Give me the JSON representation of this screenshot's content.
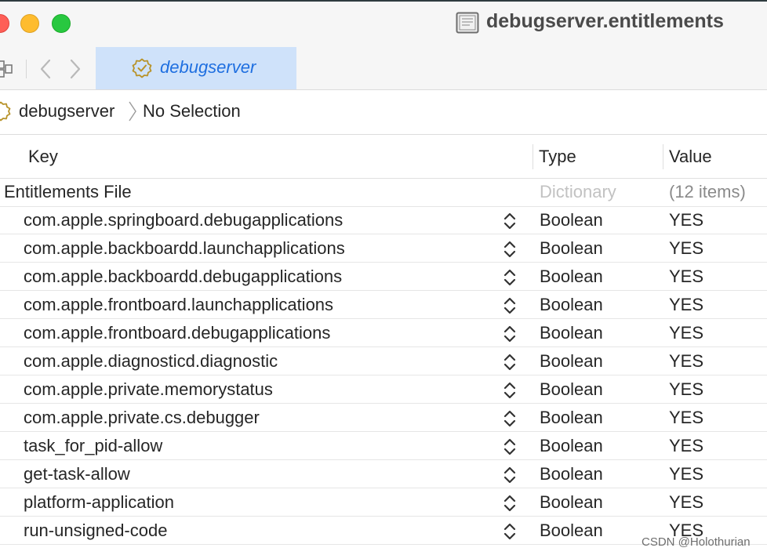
{
  "window": {
    "title": "debugserver.entitlements"
  },
  "tab": {
    "label": "debugserver"
  },
  "jump_bar": {
    "item": "debugserver",
    "selection": "No Selection"
  },
  "table": {
    "columns": [
      "Key",
      "Type",
      "Value"
    ],
    "root": {
      "key": "Entitlements File",
      "type": "Dictionary",
      "value": "(12 items)"
    },
    "rows": [
      {
        "key": "com.apple.springboard.debugapplications",
        "type": "Boolean",
        "value": "YES"
      },
      {
        "key": "com.apple.backboardd.launchapplications",
        "type": "Boolean",
        "value": "YES"
      },
      {
        "key": "com.apple.backboardd.debugapplications",
        "type": "Boolean",
        "value": "YES"
      },
      {
        "key": "com.apple.frontboard.launchapplications",
        "type": "Boolean",
        "value": "YES"
      },
      {
        "key": "com.apple.frontboard.debugapplications",
        "type": "Boolean",
        "value": "YES"
      },
      {
        "key": "com.apple.diagnosticd.diagnostic",
        "type": "Boolean",
        "value": "YES"
      },
      {
        "key": "com.apple.private.memorystatus",
        "type": "Boolean",
        "value": "YES"
      },
      {
        "key": "com.apple.private.cs.debugger",
        "type": "Boolean",
        "value": "YES"
      },
      {
        "key": "task_for_pid-allow",
        "type": "Boolean",
        "value": "YES"
      },
      {
        "key": "get-task-allow",
        "type": "Boolean",
        "value": "YES"
      },
      {
        "key": "platform-application",
        "type": "Boolean",
        "value": "YES"
      },
      {
        "key": "run-unsigned-code",
        "type": "Boolean",
        "value": "YES"
      }
    ]
  },
  "watermark": "CSDN @Holothurian",
  "icons": {
    "document": "plist-document-icon",
    "tab": "entitlements-badge-icon",
    "stepper": "up-down-chevron-icon"
  },
  "colors": {
    "tab_selected_bg": "#cfe2fa",
    "tab_label": "#1f6fe0",
    "badge_icon": "#b8932a"
  }
}
